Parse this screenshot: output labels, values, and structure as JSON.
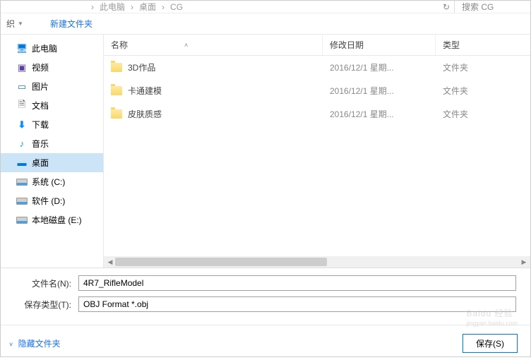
{
  "breadcrumb": {
    "part1": "此电脑",
    "sep": "›",
    "part2": "桌面",
    "part3": "CG"
  },
  "top": {
    "search_placeholder": "搜索 CG"
  },
  "toolbar": {
    "organize": "织",
    "new_folder": "新建文件夹"
  },
  "sidebar": {
    "items": [
      {
        "icon": "🖥",
        "label": "此电脑",
        "cls": "icon-monitor"
      },
      {
        "icon": "▣",
        "label": "视频",
        "cls": "icon-video"
      },
      {
        "icon": "▭",
        "label": "图片",
        "cls": "icon-pic"
      },
      {
        "icon": "🗎",
        "label": "文档",
        "cls": "icon-doc"
      },
      {
        "icon": "⬇",
        "label": "下载",
        "cls": "icon-download"
      },
      {
        "icon": "♪",
        "label": "音乐",
        "cls": "icon-music"
      },
      {
        "icon": "▬",
        "label": "桌面",
        "cls": "icon-desktop",
        "selected": true
      },
      {
        "icon": "disk",
        "label": "系统 (C:)"
      },
      {
        "icon": "disk",
        "label": "软件 (D:)"
      },
      {
        "icon": "disk",
        "label": "本地磁盘 (E:)"
      }
    ]
  },
  "columns": {
    "name": "名称",
    "date": "修改日期",
    "type": "类型"
  },
  "files": [
    {
      "name": "3D作品",
      "date": "2016/12/1 星期...",
      "type": "文件夹"
    },
    {
      "name": "卡通建模",
      "date": "2016/12/1 星期...",
      "type": "文件夹"
    },
    {
      "name": "皮肤质感",
      "date": "2016/12/1 星期...",
      "type": "文件夹"
    }
  ],
  "form": {
    "filename_label": "文件名(N):",
    "filename_value": "4R7_RifleModel",
    "filetype_label": "保存类型(T):",
    "filetype_value": "OBJ Format *.obj"
  },
  "bottom": {
    "hide_folders": "隐藏文件夹",
    "save": "保存(S)"
  },
  "watermark": {
    "main": "Baidu 经验",
    "sub": "jingyan.baidu.com"
  }
}
